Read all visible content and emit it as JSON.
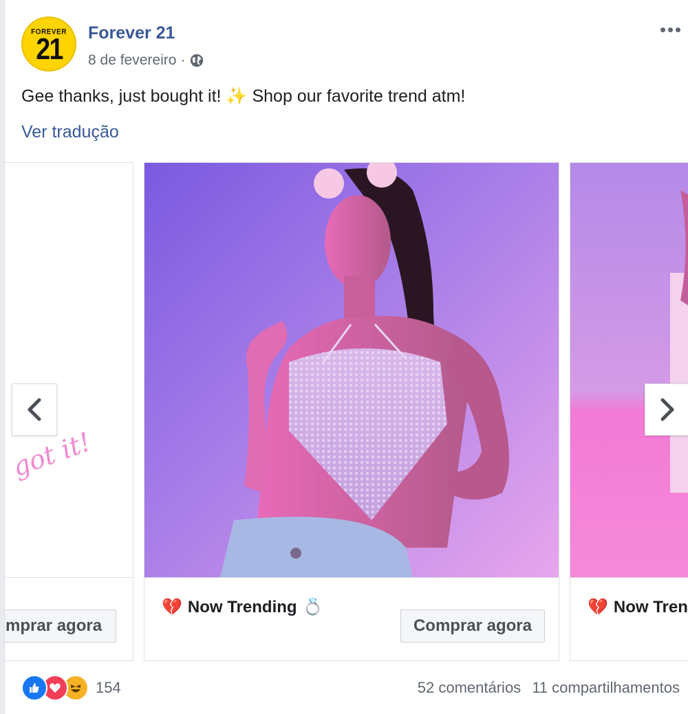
{
  "post": {
    "avatar": {
      "top_text": "FOREVER",
      "big_text": "21"
    },
    "page_name": "Forever 21",
    "date": "8 de fevereiro",
    "separator": "·",
    "text": "Gee thanks, just bought it! ✨ Shop our favorite trend atm!",
    "see_translation": "Ver tradução"
  },
  "carousel": {
    "left_card": {
      "script_text": "got it!",
      "button": "Comprar agora"
    },
    "main_card": {
      "title": "Now Trending",
      "title_prefix_emoji": "💔",
      "title_suffix_emoji": "💍",
      "button": "Comprar agora"
    },
    "right_card": {
      "title": "Now Trending",
      "title_prefix_emoji": "💔"
    }
  },
  "footer": {
    "reaction_count": "154",
    "comments": "52 comentários",
    "shares": "11 compartilhamentos"
  },
  "colors": {
    "link_blue": "#385898",
    "like_blue": "#1877f2",
    "love_red": "#f33e58",
    "haha_yellow": "#f7b125",
    "brand_yellow": "#ffd400",
    "photo_purple": "#8a5ce6",
    "photo_pink": "#f07ad8"
  },
  "icons": [
    "globe-icon",
    "more-icon",
    "chevron-left-icon",
    "chevron-right-icon",
    "like-icon",
    "love-icon",
    "haha-icon"
  ]
}
